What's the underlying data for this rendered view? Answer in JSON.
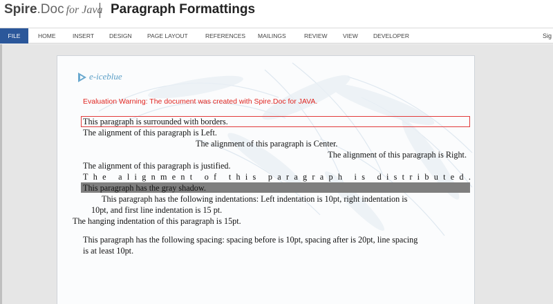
{
  "banner": {
    "brand_bold": "Spire",
    "brand_rest": ".Doc",
    "brand_for": "for Java",
    "title": "Paragraph Formattings"
  },
  "ribbon": {
    "tabs": [
      "FILE",
      "HOME",
      "INSERT",
      "DESIGN",
      "PAGE LAYOUT",
      "REFERENCES",
      "MAILINGS",
      "REVIEW",
      "VIEW",
      "DEVELOPER"
    ],
    "sign_in": "Sig"
  },
  "document": {
    "logo_text": "e-iceblue",
    "warning": "Evaluation Warning: The document was created with Spire.Doc for JAVA.",
    "bordered": "This paragraph is surrounded with borders.",
    "left": "The alignment of this paragraph is Left.",
    "center": "The alignment of this paragraph is Center.",
    "right": "The alignment of this paragraph is Right.",
    "justified": "The alignment of this paragraph is justified.",
    "distributed": "The alignment of this paragraph is distributed.",
    "shadow": "This paragraph has the gray shadow.",
    "indent_line1": "This paragraph has the following indentations: Left indentation is 10pt, right indentation is",
    "indent_line2": "10pt, and first line indentation is 15 pt.",
    "hanging": "The hanging indentation of this paragraph is 15pt.",
    "spacing_line1": "This paragraph has the following spacing: spacing before is 10pt, spacing after is 20pt, line spacing",
    "spacing_line2": "is at least 10pt."
  },
  "colors": {
    "file_tab": "#2b579a",
    "warning": "#e0241f",
    "border": "#e23a3a",
    "shadow": "#7f7f7f",
    "logo": "#5a9ec6"
  }
}
